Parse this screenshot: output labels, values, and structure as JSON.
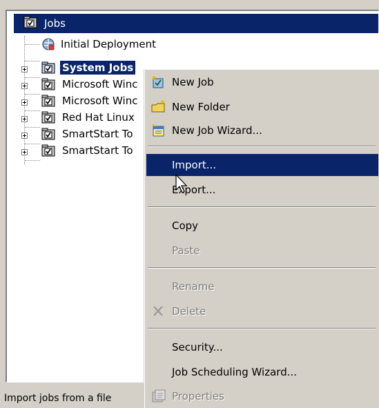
{
  "tree": {
    "root_label": "Jobs",
    "items": [
      {
        "label": "Initial Deployment"
      },
      {
        "label": "System Jobs"
      },
      {
        "label": "Microsoft Winc"
      },
      {
        "label": "Microsoft Winc"
      },
      {
        "label": "Red Hat Linux"
      },
      {
        "label": "SmartStart To"
      },
      {
        "label": "SmartStart To"
      }
    ]
  },
  "status": {
    "text": "Import jobs from a file"
  },
  "menu": {
    "new_job": "New Job",
    "new_folder": "New Folder",
    "new_job_wizard": "New Job Wizard...",
    "import": "Import...",
    "export": "Export...",
    "copy": "Copy",
    "paste": "Paste",
    "rename": "Rename",
    "delete": "Delete",
    "security": "Security...",
    "job_scheduling_wizard": "Job Scheduling Wizard...",
    "properties": "Properties"
  },
  "colors": {
    "selection": "#0a246a",
    "face": "#d4d0c8",
    "disabled": "#808080"
  }
}
